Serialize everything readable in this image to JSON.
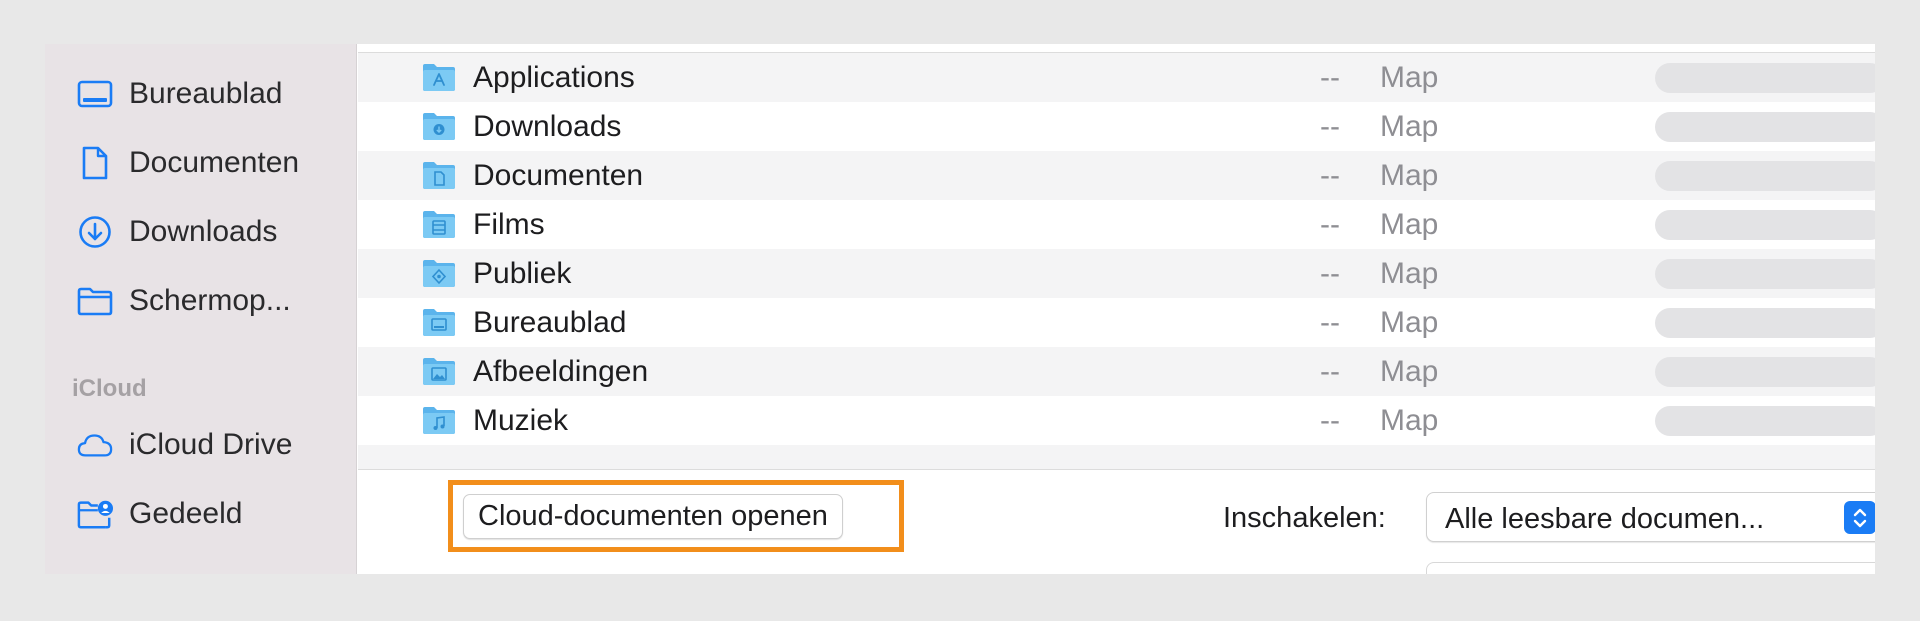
{
  "sidebar": {
    "favorites": [
      {
        "label": "Bureaublad",
        "icon": "desktop-icon"
      },
      {
        "label": "Documenten",
        "icon": "document-icon"
      },
      {
        "label": "Downloads",
        "icon": "download-icon"
      },
      {
        "label": "Schermop...",
        "icon": "folder-icon"
      }
    ],
    "icloud_section_title": "iCloud",
    "icloud": [
      {
        "label": "iCloud Drive",
        "icon": "cloud-icon"
      },
      {
        "label": "Gedeeld",
        "icon": "shared-folder-icon"
      }
    ],
    "accent_color": "#1a7cf5"
  },
  "file_list": {
    "rows": [
      {
        "name": "Applications",
        "size": "--",
        "kind": "Map",
        "icon": "applications-folder-icon"
      },
      {
        "name": "Downloads",
        "size": "--",
        "kind": "Map",
        "icon": "downloads-folder-icon"
      },
      {
        "name": "Documenten",
        "size": "--",
        "kind": "Map",
        "icon": "documents-folder-icon"
      },
      {
        "name": "Films",
        "size": "--",
        "kind": "Map",
        "icon": "movies-folder-icon"
      },
      {
        "name": "Publiek",
        "size": "--",
        "kind": "Map",
        "icon": "public-folder-icon"
      },
      {
        "name": "Bureaublad",
        "size": "--",
        "kind": "Map",
        "icon": "desktop-folder-icon"
      },
      {
        "name": "Afbeeldingen",
        "size": "--",
        "kind": "Map",
        "icon": "pictures-folder-icon"
      },
      {
        "name": "Muziek",
        "size": "--",
        "kind": "Map",
        "icon": "music-folder-icon"
      }
    ]
  },
  "footer": {
    "cloud_button_label": "Cloud-documenten openen",
    "highlight_color": "#f28e1b",
    "enable_label": "Inschakelen:",
    "enable_value": "Alle leesbare documen..."
  }
}
